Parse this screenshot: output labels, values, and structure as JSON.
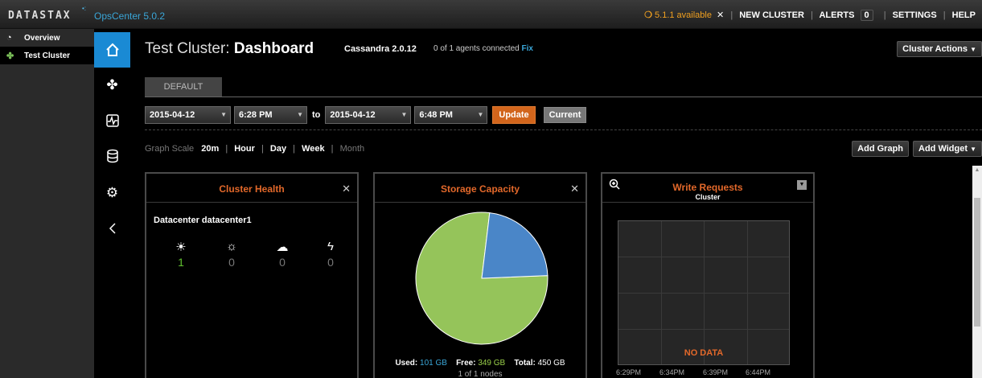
{
  "topbar": {
    "logo": "DATASTAX",
    "product": "OpsCenter 5.0.2",
    "update_notice": "5.1.1 available",
    "update_close": "✕",
    "new_cluster": "NEW CLUSTER",
    "alerts_label": "ALERTS",
    "alerts_count": "0",
    "settings": "SETTINGS",
    "help": "HELP"
  },
  "sidebar": {
    "items": [
      {
        "label": "Overview",
        "icon": "gauge-icon"
      },
      {
        "label": "Test Cluster",
        "icon": "cluster-icon"
      }
    ]
  },
  "iconbar": [
    "home-icon",
    "nodes-icon",
    "activity-icon",
    "database-icon",
    "gear-icon",
    "collapse-icon"
  ],
  "header": {
    "cluster_name": "Test Cluster:",
    "page": "Dashboard",
    "cassandra": "Cassandra 2.0.12",
    "agents": "0 of 1 agents connected",
    "fix": "Fix",
    "cluster_actions": "Cluster Actions"
  },
  "tabs": [
    {
      "label": "DEFAULT"
    }
  ],
  "range": {
    "from_date": "2015-04-12",
    "from_time": "6:28 PM",
    "to_label": "to",
    "to_date": "2015-04-12",
    "to_time": "6:48 PM",
    "update": "Update",
    "current": "Current"
  },
  "scale": {
    "label": "Graph Scale",
    "options": [
      "20m",
      "Hour",
      "Day",
      "Week",
      "Month"
    ],
    "selected": "20m"
  },
  "actions": {
    "add_graph": "Add Graph",
    "add_widget": "Add Widget"
  },
  "widgets": {
    "health": {
      "title": "Cluster Health",
      "close": "✕",
      "datacenter": "Datacenter datacenter1",
      "stats": [
        {
          "icon": "sun-icon",
          "value": "1"
        },
        {
          "icon": "partly-sunny-icon",
          "value": "0"
        },
        {
          "icon": "cloud-icon",
          "value": "0"
        },
        {
          "icon": "lightning-icon",
          "value": "0"
        }
      ]
    },
    "storage": {
      "title": "Storage Capacity",
      "close": "✕",
      "used_label": "Used:",
      "used": "101 GB",
      "free_label": "Free:",
      "free": "349 GB",
      "total_label": "Total:",
      "total": "450 GB",
      "nodes": "1 of 1 nodes",
      "used_color": "#4a86c8",
      "free_color": "#95c45a"
    },
    "writes": {
      "title": "Write Requests",
      "subtitle": "Cluster",
      "no_data": "NO DATA",
      "x_ticks": [
        "6:29PM",
        "6:34PM",
        "6:39PM",
        "6:44PM"
      ]
    }
  }
}
